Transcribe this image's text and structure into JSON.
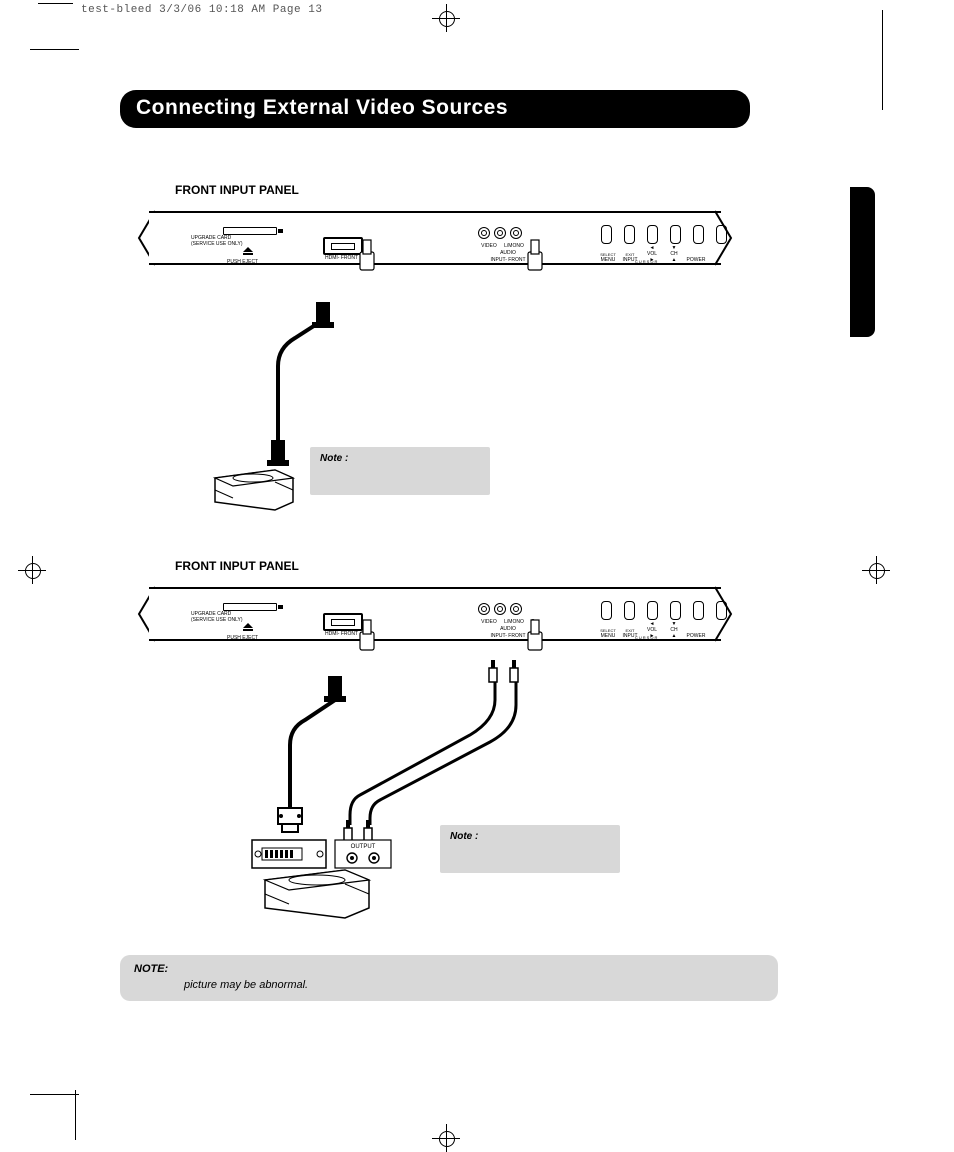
{
  "slug": "test-bleed  3/3/06  10:18 AM  Page 13",
  "title": "Connecting External Video Sources",
  "section1": {
    "label": "FRONT INPUT PANEL",
    "panel": {
      "upgrade_card": "UPGRADE CARD",
      "service_only": "(SERVICE USE ONLY)",
      "push_eject": "PUSH EJECT",
      "hdmi": "HDMI- FRONT",
      "av_row1": "VIDEO  L/MONO  R",
      "av_row2": "AUDIO",
      "input_front": "INPUT- FRONT",
      "buttons": [
        "MENU",
        "INPUT",
        "VOL",
        "CH",
        "POWER"
      ],
      "subbuttons": [
        "SELECT",
        "EXIT",
        "◄      ►",
        "▼      ▲",
        ""
      ],
      "cursor": "CURSOR"
    },
    "note_label": "Note :"
  },
  "section2": {
    "label": "FRONT INPUT PANEL",
    "panel": {
      "upgrade_card": "UPGRADE CARD",
      "service_only": "(SERVICE USE ONLY)",
      "push_eject": "PUSH EJECT",
      "hdmi": "HDMI- FRONT",
      "av_row1": "VIDEO  L/MONO  R",
      "av_row2": "AUDIO",
      "input_front": "INPUT- FRONT",
      "buttons": [
        "MENU",
        "INPUT",
        "VOL",
        "CH",
        "POWER"
      ],
      "subbuttons": [
        "SELECT",
        "EXIT",
        "◄      ►",
        "▼      ▲",
        ""
      ],
      "cursor": "CURSOR"
    },
    "output_label": "OUTPUT",
    "note_label": "Note :"
  },
  "bottom_note": {
    "heading": "NOTE:",
    "body": "picture may be abnormal."
  }
}
